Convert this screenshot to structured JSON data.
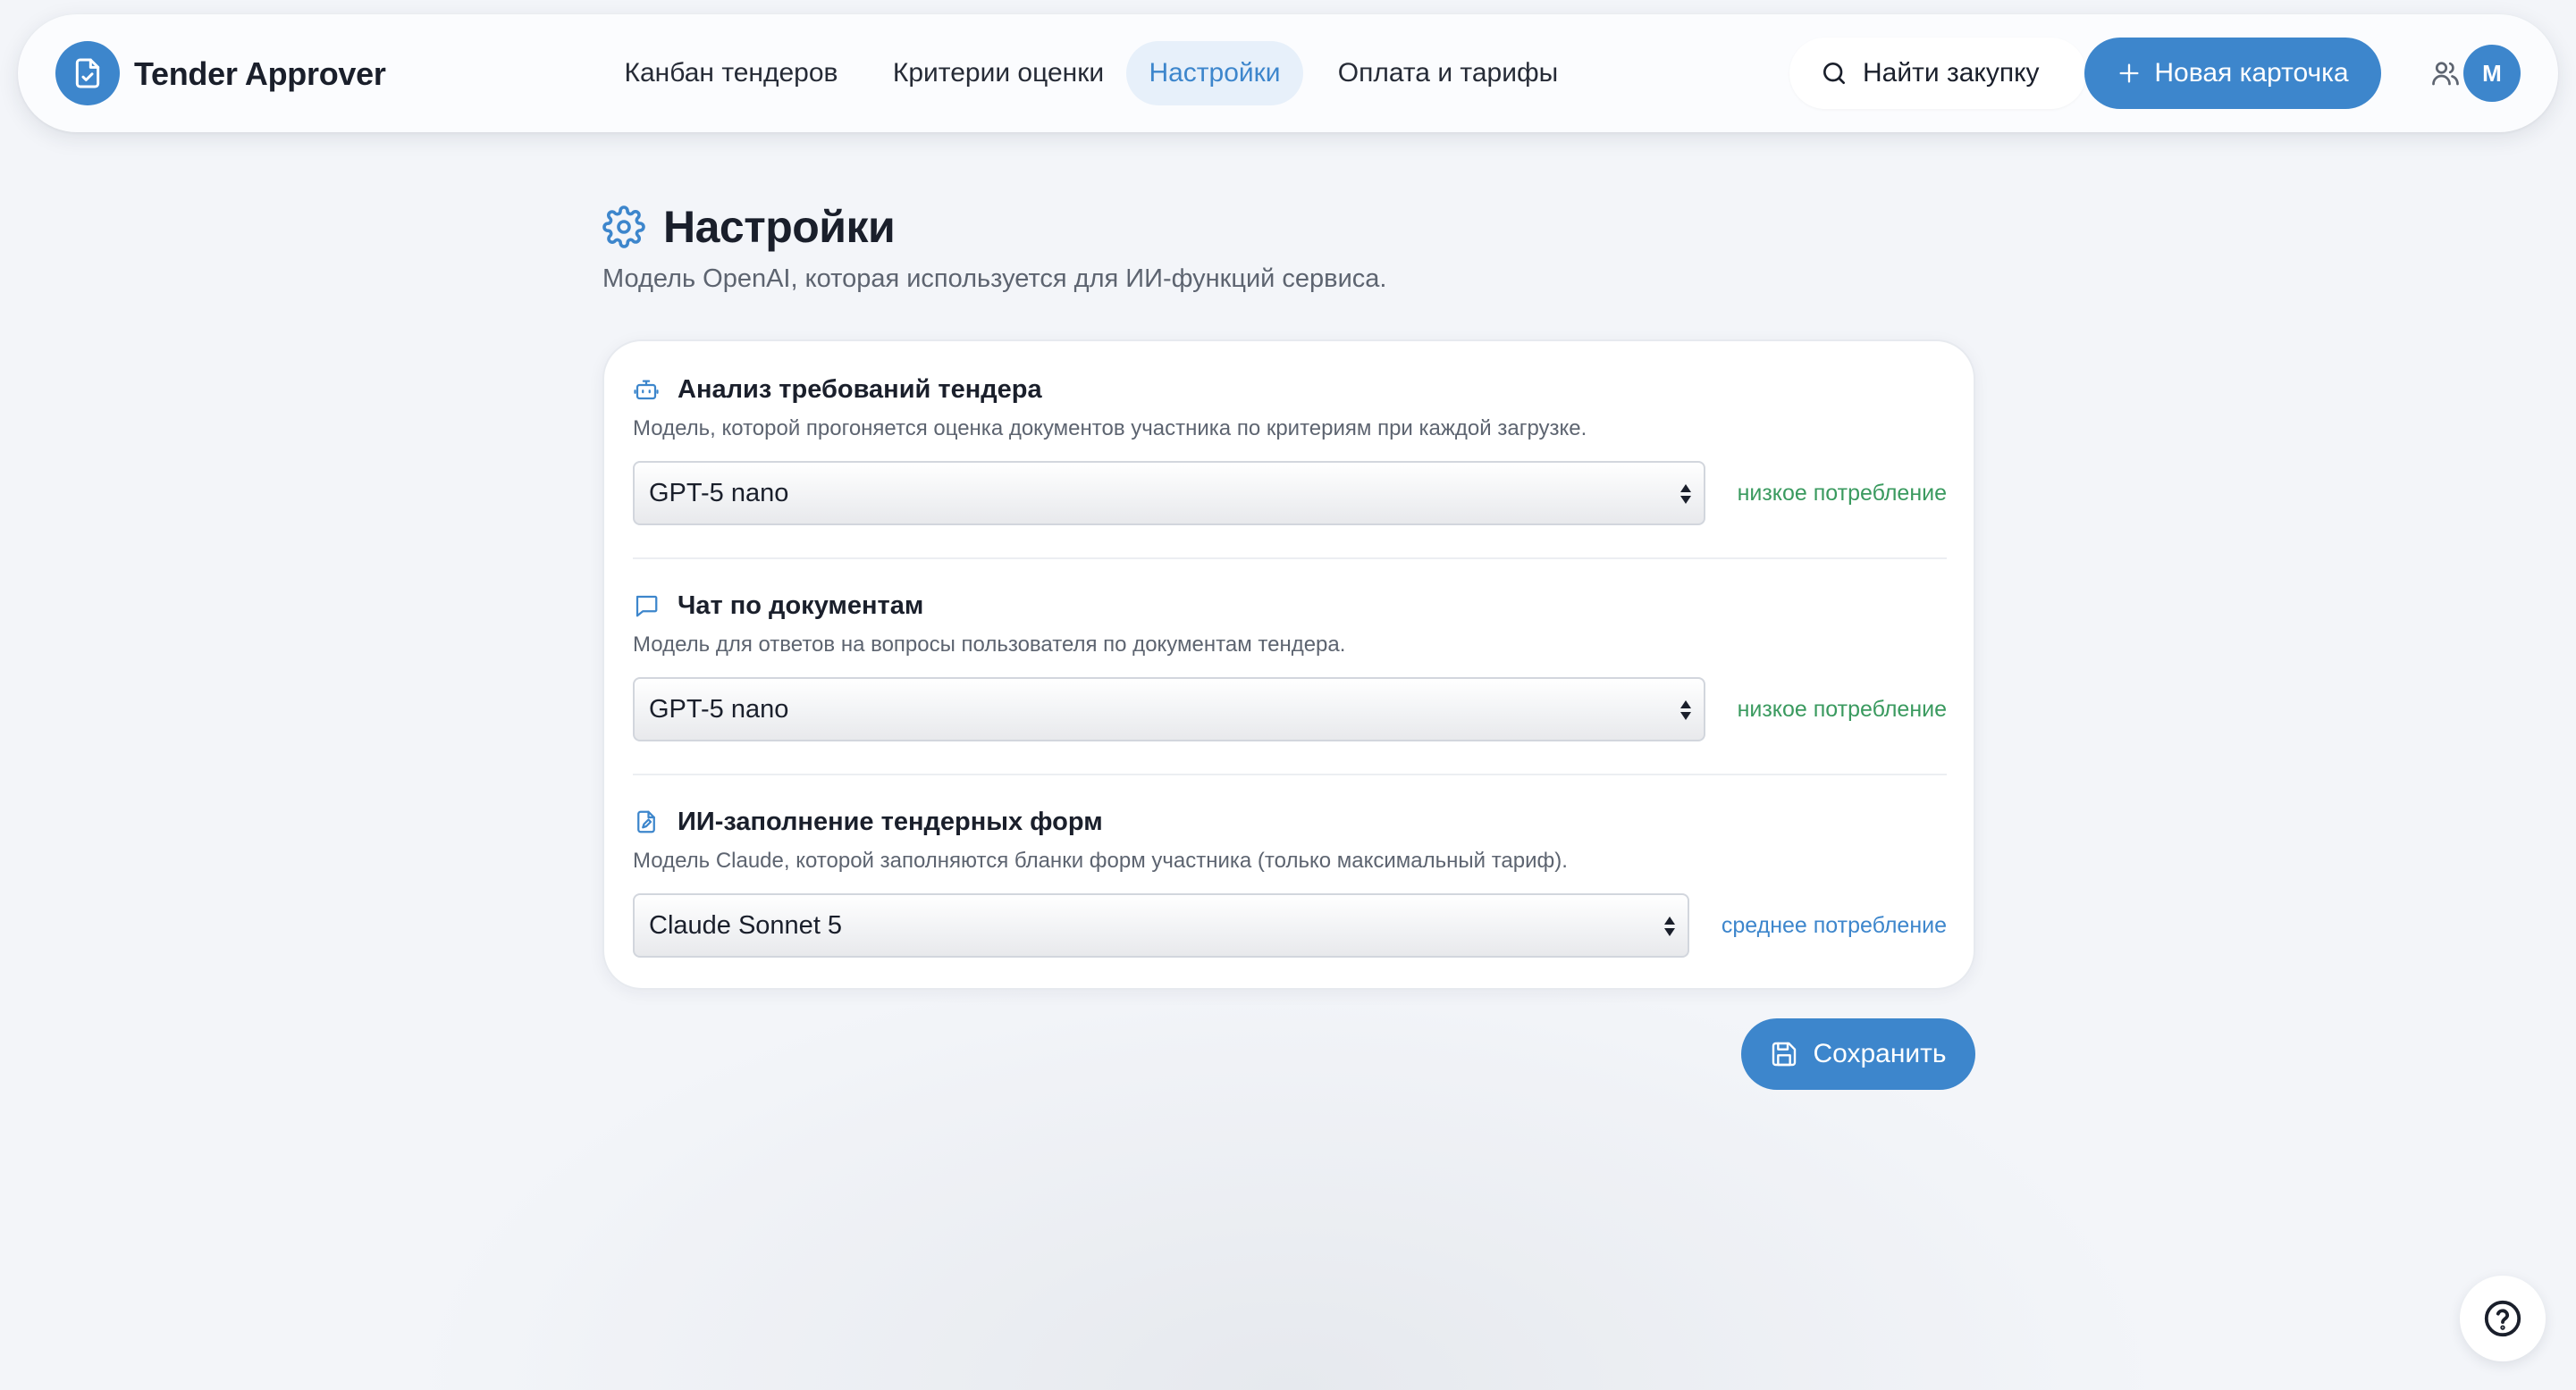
{
  "app": {
    "brand": "Tender Approver",
    "accent_color": "#3d86cc"
  },
  "nav": {
    "items": [
      {
        "label": "Канбан тендеров",
        "active": false
      },
      {
        "label": "Критерии оценки",
        "active": false
      },
      {
        "label": "Настройки",
        "active": true
      },
      {
        "label": "Оплата и тарифы",
        "active": false
      }
    ]
  },
  "header": {
    "search_label": "Найти закупку",
    "new_card_label": "Новая карточка",
    "avatar_initial": "M"
  },
  "page": {
    "title": "Настройки",
    "subtitle": "Модель OpenAI, которая используется для ИИ-функций сервиса."
  },
  "sections": [
    {
      "icon": "robot-icon",
      "title": "Анализ требований тендера",
      "description": "Модель, которой прогоняется оценка документов участника по критериям при каждой загрузке.",
      "selected": "GPT-5 nano",
      "usage": "низкое потребление",
      "usage_color": "#3a9a5f"
    },
    {
      "icon": "chat-icon",
      "title": "Чат по документам",
      "description": "Модель для ответов на вопросы пользователя по документам тендера.",
      "selected": "GPT-5 nano",
      "usage": "низкое потребление",
      "usage_color": "#3a9a5f"
    },
    {
      "icon": "document-edit-icon",
      "title": "ИИ-заполнение тендерных форм",
      "description": "Модель Claude, которой заполняются бланки форм участника (только максимальный тариф).",
      "selected": "Claude Sonnet 5",
      "usage": "среднее потребление",
      "usage_color": "#3d86cc"
    }
  ],
  "actions": {
    "save_label": "Сохранить"
  }
}
